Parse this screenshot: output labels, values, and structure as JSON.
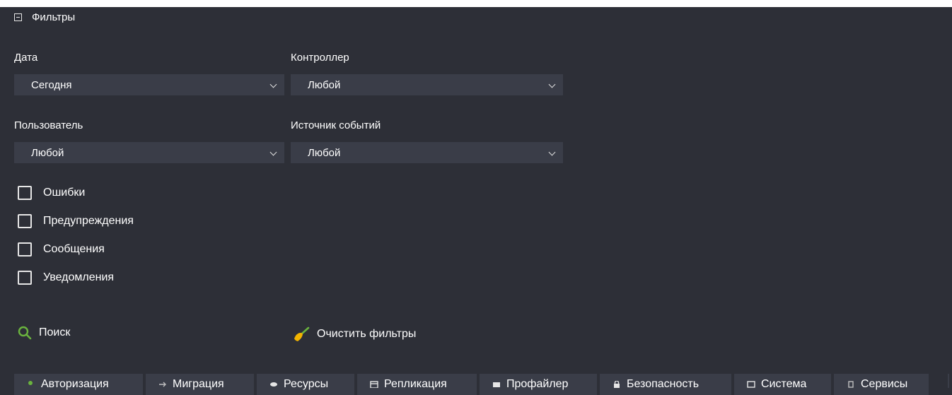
{
  "filters_header": {
    "title": "Фильтры"
  },
  "fields": {
    "date": {
      "label": "Дата",
      "value": "Сегодня"
    },
    "controller": {
      "label": "Контроллер",
      "value": "Любой"
    },
    "user": {
      "label": "Пользователь",
      "value": "Любой"
    },
    "event_source": {
      "label": "Источник событий",
      "value": "Любой"
    }
  },
  "checkboxes": [
    {
      "label": "Ошибки",
      "checked": false
    },
    {
      "label": "Предупреждения",
      "checked": false
    },
    {
      "label": "Сообщения",
      "checked": false
    },
    {
      "label": "Уведомления",
      "checked": false
    }
  ],
  "actions": {
    "search": "Поиск",
    "clear": "Очистить фильтры"
  },
  "tabs": [
    {
      "label": "Авторизация",
      "icon": "key-icon"
    },
    {
      "label": "Миграция",
      "icon": "migration-icon"
    },
    {
      "label": "Ресурсы",
      "icon": "database-icon"
    },
    {
      "label": "Репликация",
      "icon": "calendar-icon"
    },
    {
      "label": "Профайлер",
      "icon": "profiler-icon"
    },
    {
      "label": "Безопасность",
      "icon": "lock-icon"
    },
    {
      "label": "Система",
      "icon": "monitor-icon"
    },
    {
      "label": "Сервисы",
      "icon": "services-icon"
    }
  ],
  "colors": {
    "background": "#2d2f37",
    "field": "#3a3d48",
    "accent_green": "#6ab33e",
    "broom_yellow": "#f2b400"
  }
}
